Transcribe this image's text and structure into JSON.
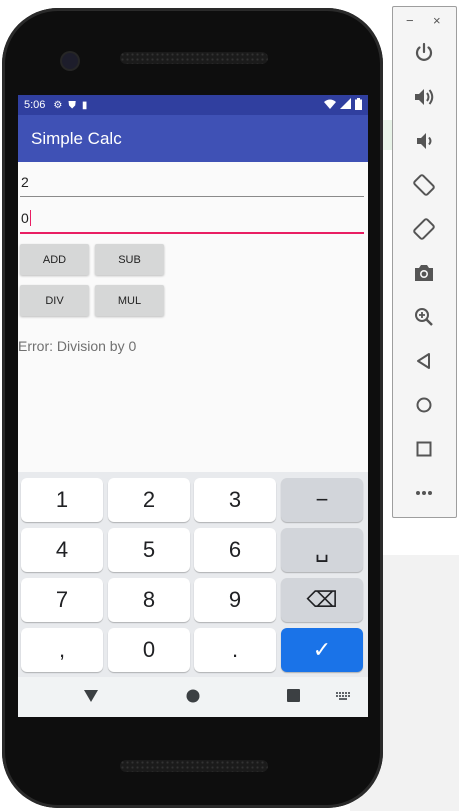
{
  "status": {
    "time": "5:06"
  },
  "app": {
    "title": "Simple Calc"
  },
  "inputs": {
    "first_value": "2",
    "second_value": "0"
  },
  "buttons": {
    "add": "ADD",
    "sub": "SUB",
    "div": "DIV",
    "mul": "MUL"
  },
  "result": "Error: Division by 0",
  "keyboard": {
    "row1": [
      "1",
      "2",
      "3",
      "−"
    ],
    "row2": [
      "4",
      "5",
      "6",
      "␣"
    ],
    "row3": [
      "7",
      "8",
      "9",
      "⌫"
    ],
    "row4": [
      ",",
      "0",
      ".",
      "✓"
    ]
  },
  "toolbar": {
    "minimize": "−",
    "close": "×",
    "icons": [
      "power-icon",
      "volume-up-icon",
      "volume-down-icon",
      "rotate-left-icon",
      "rotate-right-icon",
      "camera-icon",
      "zoom-icon",
      "back-icon",
      "home-icon",
      "overview-icon",
      "more-icon"
    ]
  },
  "colors": {
    "status_bar": "#303f9f",
    "app_bar": "#3f51b5",
    "accent": "#e91e63",
    "enter_key": "#1a73e8"
  }
}
